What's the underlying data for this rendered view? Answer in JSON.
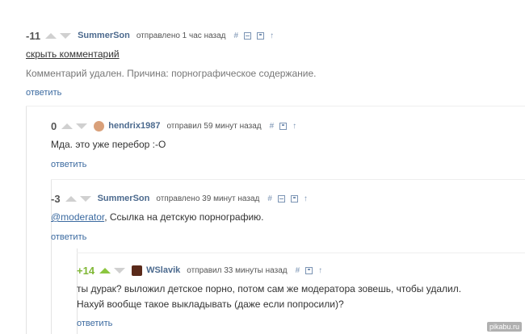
{
  "comments": [
    {
      "rating": "-11",
      "user": "SummerSon",
      "meta": "отправлено 1 час назад",
      "hide_label": "скрыть комментарий",
      "deleted_text": "Комментарий удален. Причина: порнографическое содержание.",
      "reply_label": "ответить"
    },
    {
      "rating": "0",
      "user": "hendrix1987",
      "meta": "отправил 59 минут назад",
      "text": "Мда. это уже перебор :-О",
      "reply_label": "ответить"
    },
    {
      "rating": "-3",
      "user": "SummerSon",
      "meta": "отправлено 39 минут назад",
      "mention": "@moderator",
      "text": ", Ссылка на детскую порнографию.",
      "reply_label": "ответить"
    },
    {
      "rating": "+14",
      "user": "WSlavik",
      "meta": "отправил 33 минуты назад",
      "text_line1": "ты дурак? выложил детское порно, потом сам же модератора зовешь, чтобы удалил.",
      "text_line2": "Нахуй вообще такое выкладывать (даже если попросили)?",
      "reply_label": "ответить"
    }
  ],
  "icons": {
    "hash": "#",
    "arrow_up": "↑",
    "minus_box": "minus-box-icon",
    "save": "save-icon"
  },
  "colors": {
    "link": "#3b6aa0",
    "username": "#4c6a8e",
    "positive": "#7fb735"
  },
  "watermark": "pikabu.ru"
}
